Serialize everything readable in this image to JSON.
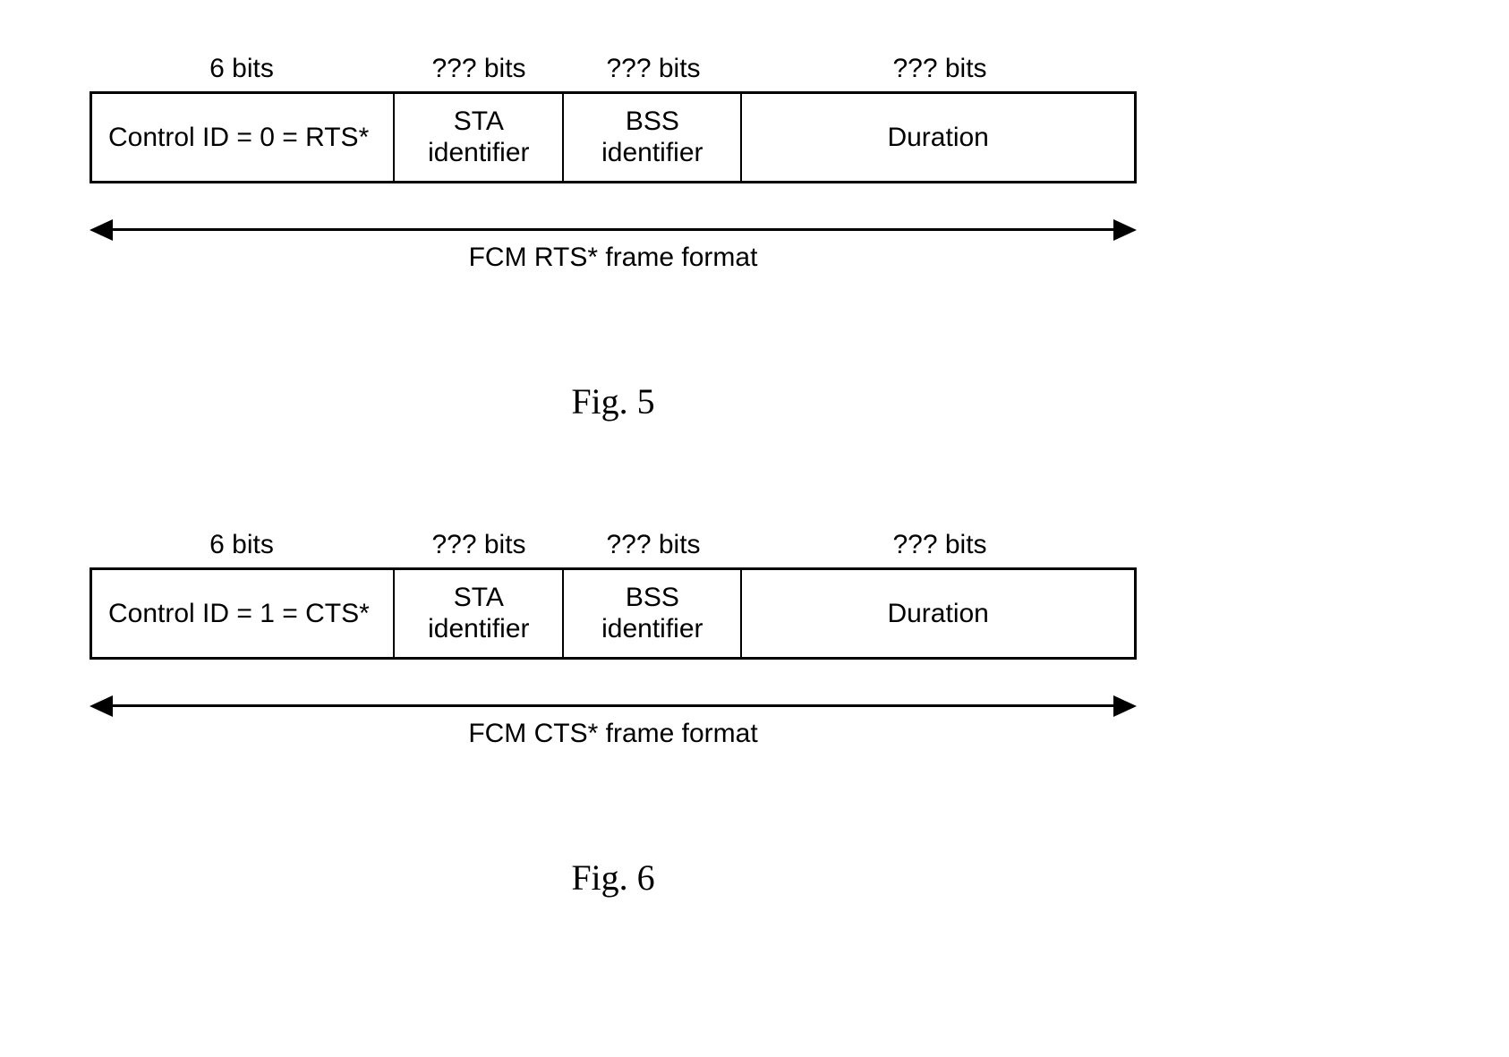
{
  "fig5": {
    "bits": {
      "c1": "6 bits",
      "c2": "??? bits",
      "c3": "??? bits",
      "c4": "??? bits"
    },
    "cells": {
      "c1": "Control ID = 0 = RTS*",
      "c2a": "STA",
      "c2b": "identifier",
      "c3a": "BSS",
      "c3b": "identifier",
      "c4": "Duration"
    },
    "arrow_caption": "FCM RTS* frame format",
    "caption": "Fig. 5"
  },
  "fig6": {
    "bits": {
      "c1": "6 bits",
      "c2": "??? bits",
      "c3": "??? bits",
      "c4": "??? bits"
    },
    "cells": {
      "c1": "Control ID = 1 = CTS*",
      "c2a": "STA",
      "c2b": "identifier",
      "c3a": "BSS",
      "c3b": "identifier",
      "c4": "Duration"
    },
    "arrow_caption": "FCM CTS* frame format",
    "caption": "Fig. 6"
  }
}
